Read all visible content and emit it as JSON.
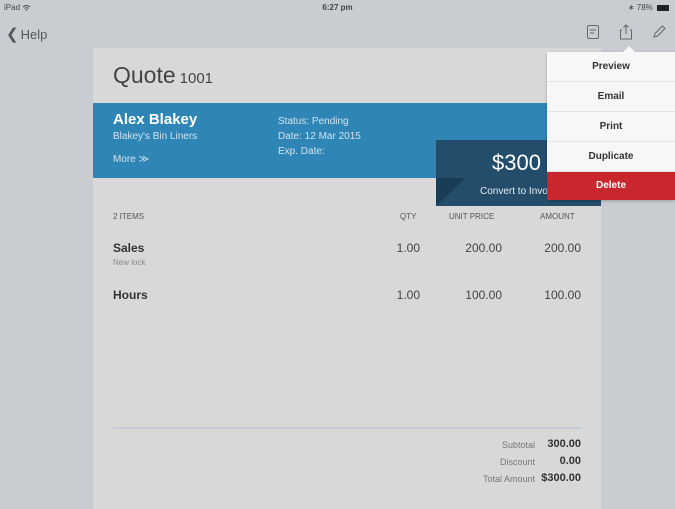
{
  "status_bar": {
    "device": "iPad",
    "time": "6:27 pm",
    "battery": "78%"
  },
  "nav": {
    "back_label": "Help"
  },
  "quote": {
    "title": "Quote",
    "number": "1001"
  },
  "customer": {
    "name": "Alex Blakey",
    "company": "Blakey's Bin Liners",
    "more_label": "More"
  },
  "status": {
    "status": "Status: Pending",
    "date": "Date: 12 Mar 2015",
    "exp_date": "Exp. Date:"
  },
  "total_box": {
    "amount": "$300",
    "convert_label": "Convert to Invo"
  },
  "table": {
    "headers": {
      "items": "2 ITEMS",
      "qty": "QTY",
      "unit_price": "UNIT PRICE",
      "amount": "AMOUNT"
    },
    "rows": [
      {
        "name": "Sales",
        "description": "New lock",
        "qty": "1.00",
        "unit_price": "200.00",
        "amount": "200.00"
      },
      {
        "name": "Hours",
        "description": "",
        "qty": "1.00",
        "unit_price": "100.00",
        "amount": "100.00"
      }
    ]
  },
  "totals": {
    "subtotal_label": "Subtotal",
    "subtotal": "300.00",
    "discount_label": "Discount",
    "discount": "0.00",
    "total_label": "Total Amount",
    "total": "$300.00"
  },
  "menu": {
    "items": [
      "Preview",
      "Email",
      "Print",
      "Duplicate",
      "Delete"
    ]
  },
  "icons": [
    "wifi-icon",
    "bluetooth-icon",
    "battery-icon",
    "back-chevron-icon",
    "notes-icon",
    "share-icon",
    "edit-pencil-icon",
    "double-chevron-down-icon"
  ],
  "colors": {
    "header": "#2f86b6",
    "total_box": "#244d6b",
    "delete": "#c8282d"
  }
}
